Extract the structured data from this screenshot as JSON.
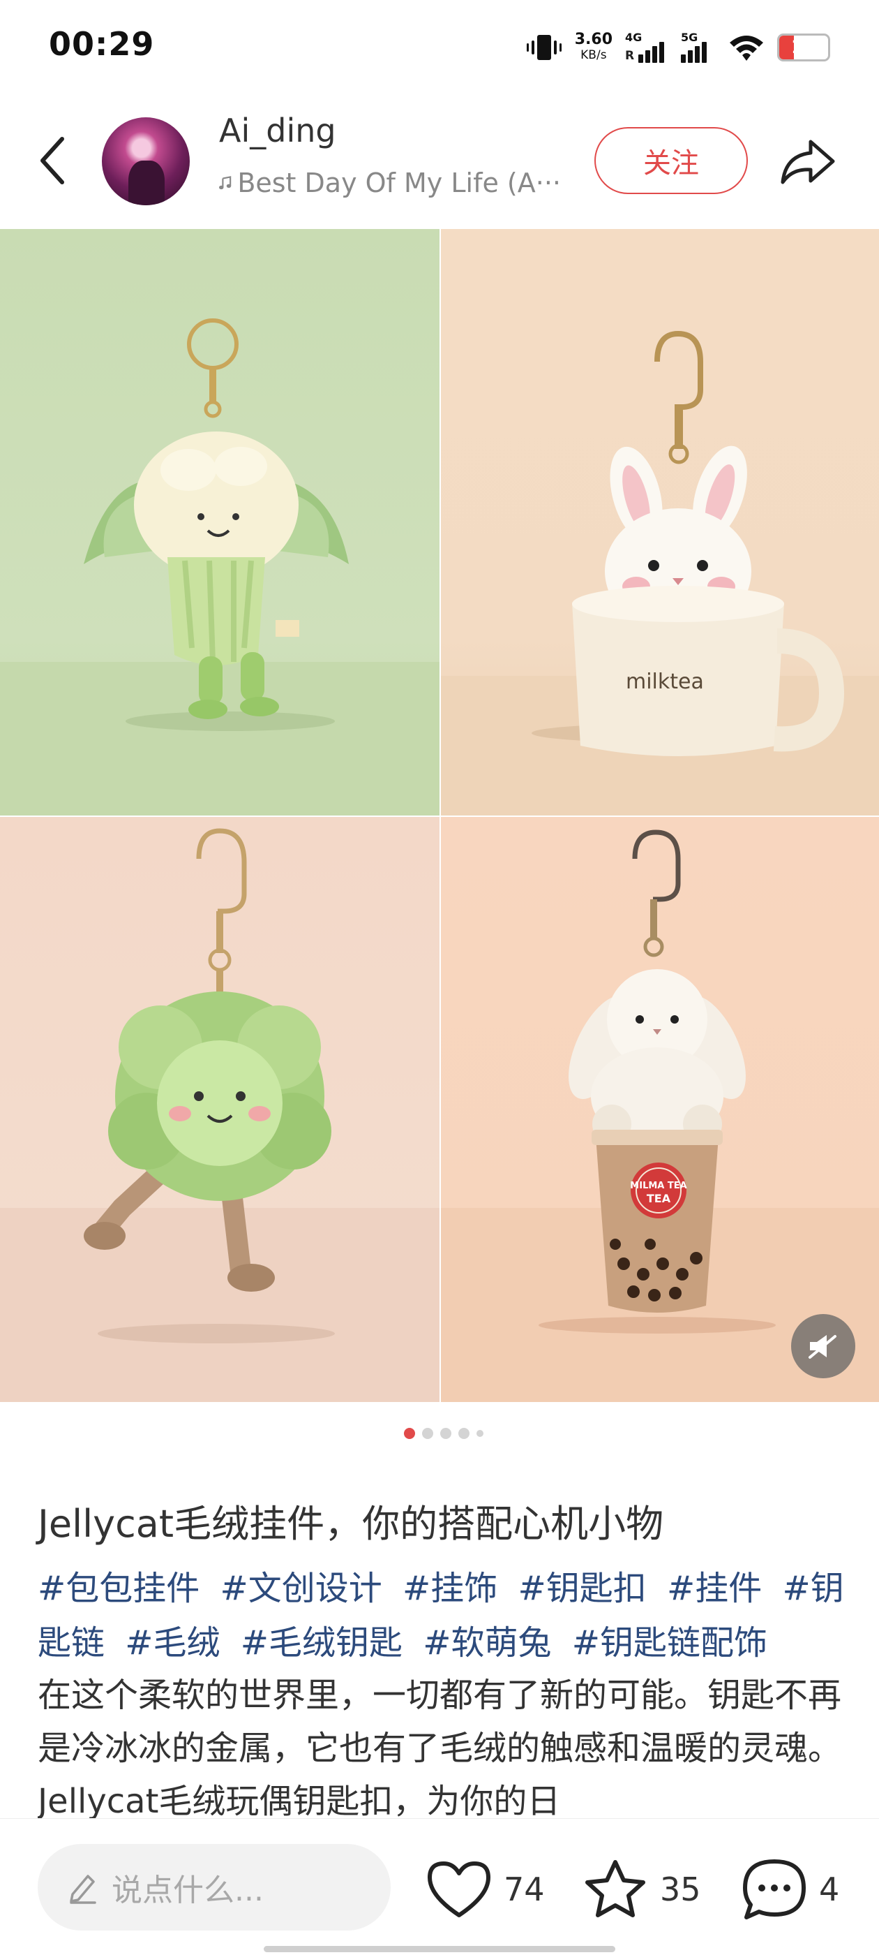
{
  "status_bar": {
    "time": "00:29",
    "net_speed": "3.60",
    "net_speed_unit": "KB/s",
    "signal1_label": "4G",
    "signal2_label": "5G",
    "battery_level": "16",
    "battery_color": "#e8413d"
  },
  "header": {
    "username": "Ai_ding",
    "music": "Best Day Of My Life (A···",
    "follow_label": "关注",
    "back_icon": "chevron-left-icon",
    "share_icon": "share-arrow-icon"
  },
  "gallery": {
    "images": [
      {
        "name": "cauliflower-keychain"
      },
      {
        "name": "bunny-milktea-keychain",
        "text": "milktea"
      },
      {
        "name": "cabbage-keychain"
      },
      {
        "name": "bunny-bubble-tea-keychain",
        "text": "MILMA TEA TEA"
      }
    ],
    "page_count": 5,
    "current_page": 1
  },
  "post": {
    "title": "Jellycat毛绒挂件，你的搭配心机小物",
    "tags": [
      "#包包挂件",
      "#文创设计",
      "#挂饰",
      "#钥匙扣",
      "#挂件",
      "#钥匙链",
      "#毛绒",
      "#毛绒钥匙",
      "#软萌兔",
      "#钥匙链配饰"
    ],
    "body": "在这个柔软的世界里，一切都有了新的可能。钥匙不再是冷冰冰的金属，它也有了毛绒的触感和温暖的灵魂。Jellycat毛绒玩偶钥匙扣，为你的日"
  },
  "bottom_bar": {
    "comment_placeholder": "说点什么...",
    "likes": "74",
    "favorites": "35",
    "comments": "4"
  },
  "colors": {
    "accent": "#e14a4a",
    "tag": "#2c4a7c"
  }
}
